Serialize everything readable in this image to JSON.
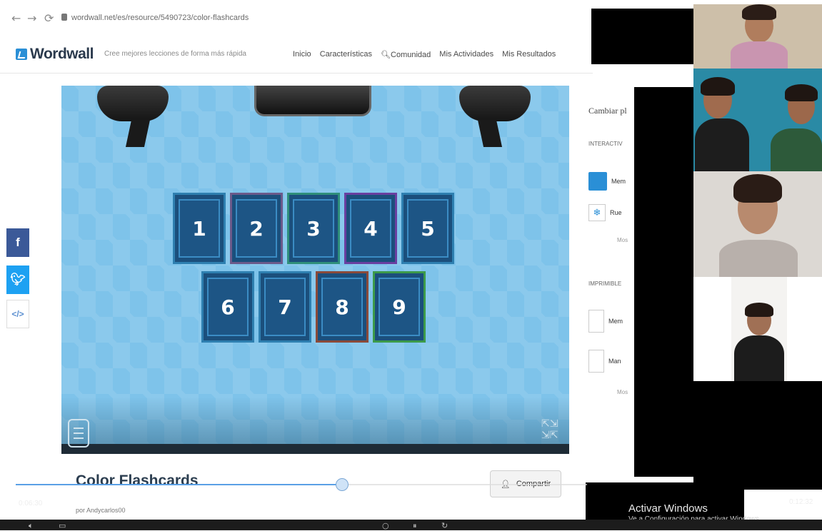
{
  "browser": {
    "url": "wordwall.net/es/resource/5490723/color-flashcards",
    "nav_icons": [
      "back-arrow-icon",
      "forward-arrow-icon",
      "reload-icon",
      "lock-icon"
    ]
  },
  "site": {
    "logo": "Wordwall",
    "tagline": "Cree mejores lecciones de forma más rápida",
    "nav": [
      "Inicio",
      "Características",
      "Comunidad",
      "Mis Actividades",
      "Mis Resultados"
    ]
  },
  "game": {
    "cards_row1": [
      "1",
      "2",
      "3",
      "4",
      "5"
    ],
    "cards_row2": [
      "6",
      "7",
      "8",
      "9"
    ],
    "title": "Color Flashcards",
    "author": "por Andycarlos00",
    "share_label": "Compartir"
  },
  "sidebar": {
    "title": "Cambiar pl",
    "interactive_heading": "INTERACTIV",
    "interactive_items": [
      "Mem",
      "Rue"
    ],
    "more_label": "Mos",
    "printable_heading": "IMPRIMIBLE",
    "printable_items": [
      "Mem",
      "Man"
    ]
  },
  "social": [
    "f",
    "t",
    "</>"
  ],
  "video": {
    "time_elapsed": "0:06:30",
    "time_total": "0:12:32",
    "progress": 0.57
  },
  "windows": {
    "activate_title": "Activar Windows",
    "activate_sub": "Ve a Configuración para activar Windows."
  },
  "colors": {
    "stage": "#7ec3ea",
    "card": "#1b4f7c",
    "accent": "#2a8fd6",
    "facebook": "#3b5998",
    "twitter": "#1da1f2"
  }
}
